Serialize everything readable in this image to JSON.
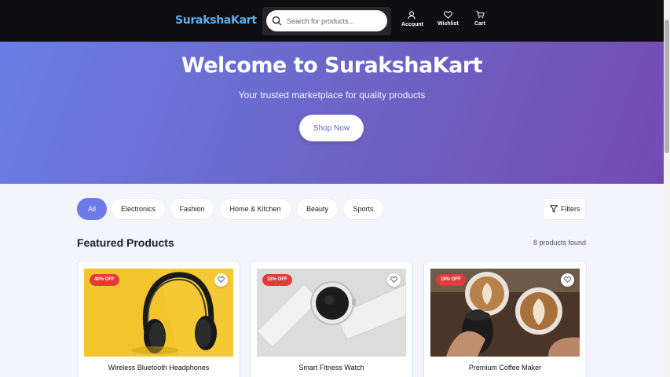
{
  "header": {
    "logo": "SurakshaKart",
    "search_placeholder": "Search for products...",
    "nav": [
      {
        "label": "Account",
        "icon": "user-icon"
      },
      {
        "label": "Wishlist",
        "icon": "heart-icon"
      },
      {
        "label": "Cart",
        "icon": "cart-icon"
      }
    ]
  },
  "hero": {
    "title": "Welcome to SurakshaKart",
    "subtitle": "Your trusted marketplace for quality products",
    "cta": "Shop Now"
  },
  "categories": [
    "All",
    "Electronics",
    "Fashion",
    "Home & Kitchen",
    "Beauty",
    "Sports"
  ],
  "active_category": "All",
  "filters_label": "Filters",
  "section": {
    "title": "Featured Products",
    "count": "8 products found"
  },
  "products": [
    {
      "name": "Wireless Bluetooth Headphones",
      "discount": "40% OFF"
    },
    {
      "name": "Smart Fitness Watch",
      "discount": "33% OFF"
    },
    {
      "name": "Premium Coffee Maker",
      "discount": "19% OFF"
    }
  ],
  "colors": {
    "header_bg": "#0e0e10",
    "logo": "#5fb0ee",
    "accent": "#6b7ae4",
    "badge": "#e23b3b",
    "hero_gradient_start": "#6a7de6",
    "hero_gradient_end": "#744ab0"
  }
}
